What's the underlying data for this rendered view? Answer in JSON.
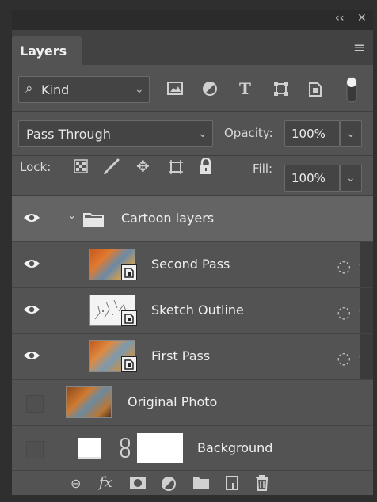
{
  "panel": {
    "collapse_glyph": "‹‹",
    "close_glyph": "✕",
    "tab_label": "Layers",
    "menu_glyph": "≡"
  },
  "filter": {
    "search_glyph": "⌕",
    "kind_label": "Kind"
  },
  "blend": {
    "mode": "Pass Through",
    "opacity_label": "Opacity:",
    "opacity_value": "100%"
  },
  "lock": {
    "label": "Lock:",
    "fill_label": "Fill:",
    "fill_value": "100%"
  },
  "layers": [
    {
      "name": "Cartoon layers",
      "type": "group",
      "visible": true
    },
    {
      "name": "Second Pass",
      "type": "smart",
      "visible": true
    },
    {
      "name": "Sketch Outline",
      "type": "smart",
      "visible": true
    },
    {
      "name": "First Pass",
      "type": "smart",
      "visible": true
    },
    {
      "name": "Original Photo",
      "type": "image",
      "visible": false
    },
    {
      "name": "Background",
      "type": "masked",
      "visible": false
    }
  ],
  "colors": {
    "panel_bg": "#535353",
    "group_row_bg": "#646464",
    "header_bg": "#424242"
  }
}
